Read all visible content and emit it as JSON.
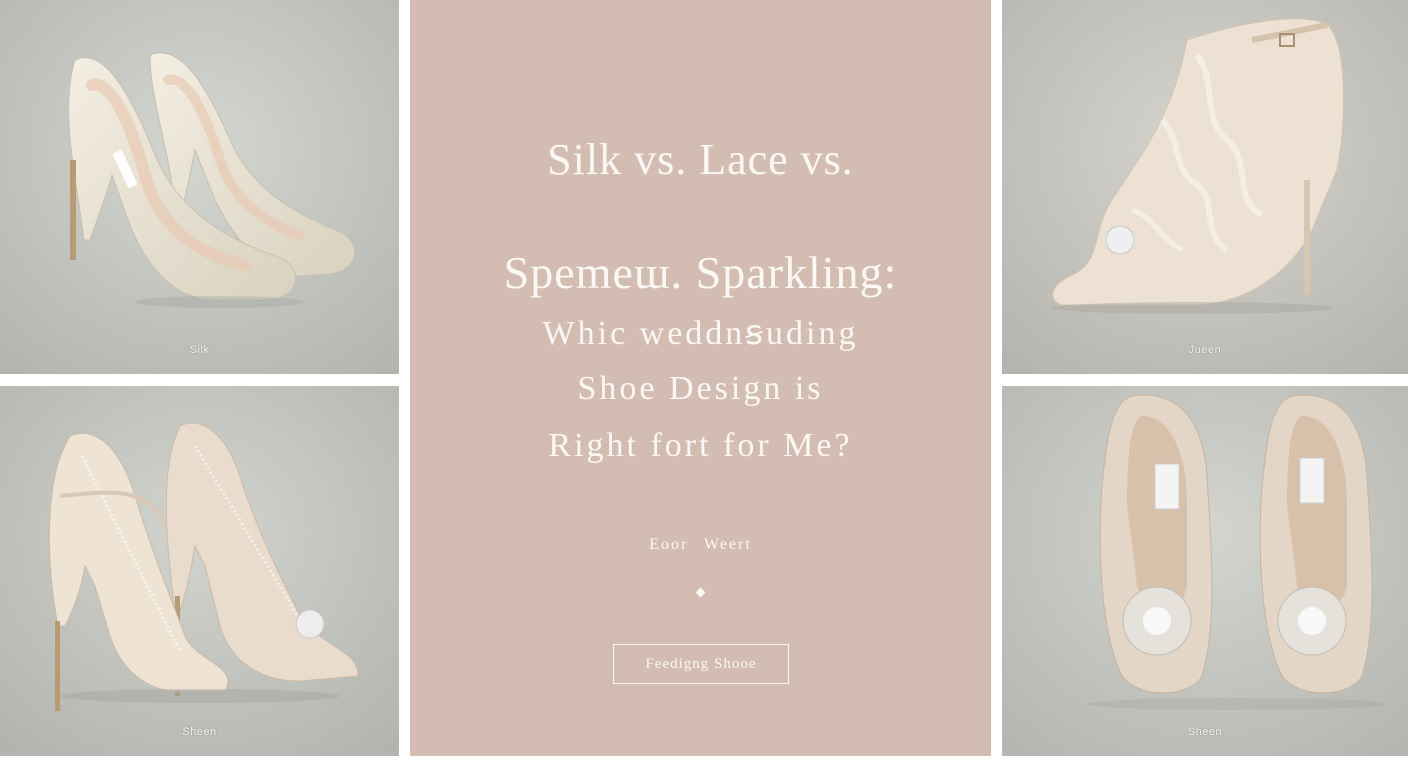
{
  "colors": {
    "center_panel": "#d3bdb2",
    "text": "#fbf8f5",
    "photo_backdrop": "#c7c9c4"
  },
  "panels": {
    "top_left": {
      "caption": "Silk",
      "image": "ivory-satin-pumps"
    },
    "bottom_left": {
      "caption": "Sheen",
      "image": "crystal-t-strap-sandals"
    },
    "top_right": {
      "caption": "Jueen",
      "image": "lace-peep-toe-bootie"
    },
    "bottom_right": {
      "caption": "Sheen",
      "image": "jeweled-peep-toe-pumps"
    }
  },
  "center": {
    "line1": "Silk vs. Lace vs.",
    "line2": "Spemeɯ. Sparkling:",
    "line3": "Whic  weddnꞩuding",
    "line4": "Shoe  Design is",
    "line5": "Right fort for Me?",
    "byline": "Eoor  Weert",
    "button_label": "Feedigng Shooe"
  }
}
